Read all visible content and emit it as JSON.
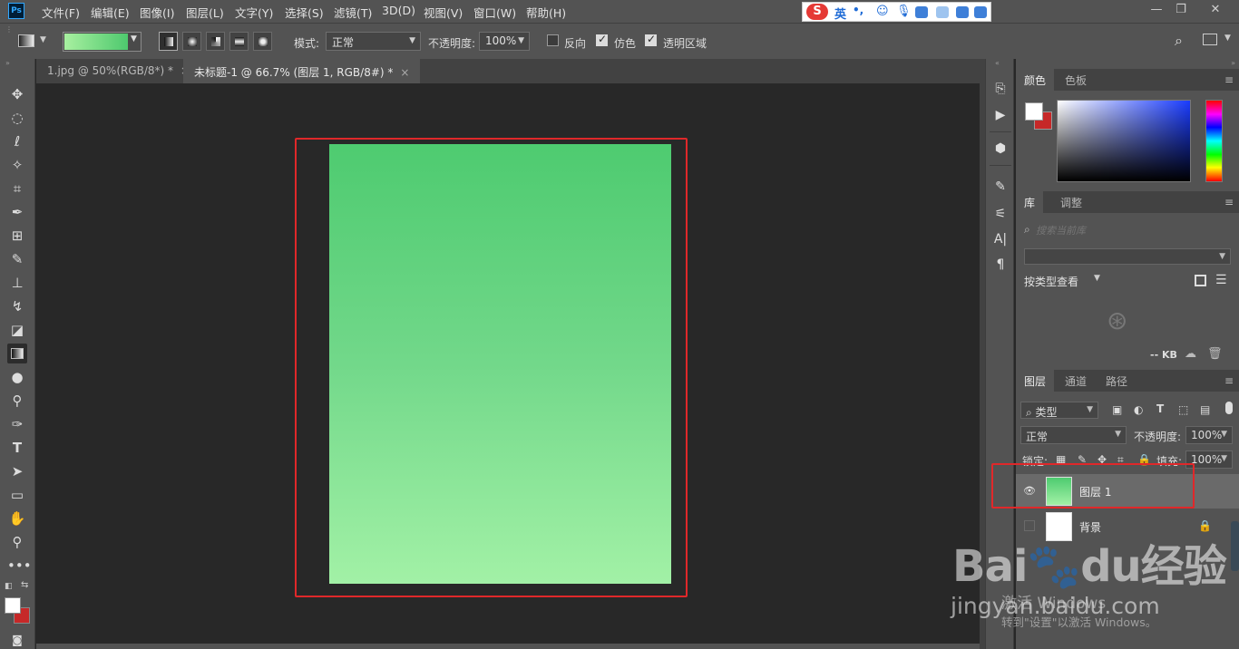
{
  "app": {
    "logo": "Ps",
    "menu": [
      "文件(F)",
      "编辑(E)",
      "图像(I)",
      "图层(L)",
      "文字(Y)",
      "选择(S)",
      "滤镜(T)",
      "3D(D)",
      "视图(V)",
      "窗口(W)",
      "帮助(H)"
    ],
    "ime": {
      "brand": "S",
      "lang": "英",
      "punct": "•,"
    }
  },
  "options": {
    "mode_label": "模式:",
    "mode_value": "正常",
    "opacity_label": "不透明度:",
    "opacity_value": "100%",
    "reverse_label": "反向",
    "reverse_checked": false,
    "dither_label": "仿色",
    "dither_checked": true,
    "transparency_label": "透明区域",
    "transparency_checked": true
  },
  "tabs": [
    {
      "label": "1.jpg @ 50%(RGB/8*) *",
      "close": "×"
    },
    {
      "label": "未标题-1 @ 66.7% (图层 1, RGB/8#) *",
      "close": "×"
    }
  ],
  "colors": {
    "foreground": "#ffffff",
    "background": "#c62828",
    "gradient_start": "#4ecb70",
    "gradient_end": "#a2f1a6",
    "highlight": "#e0282a"
  },
  "panels": {
    "color_tabs": [
      "颜色",
      "色板"
    ],
    "library_tabs": [
      "库",
      "调整"
    ],
    "library_search_placeholder": "搜索当前库",
    "library_view_label": "按类型查看",
    "library_size": "-- KB",
    "layers_tabs": [
      "图层",
      "通道",
      "路径"
    ],
    "layers_filter": "类型",
    "layers_blend": "正常",
    "layers_opacity_label": "不透明度:",
    "layers_opacity_value": "100%",
    "layers_lock_label": "锁定:",
    "layers_fill_label": "填充:",
    "layers_fill_value": "100%",
    "layers": [
      {
        "name": "图层 1",
        "visible": true,
        "selected": true
      },
      {
        "name": "背景",
        "visible": false,
        "locked": true
      }
    ]
  },
  "watermark": {
    "brand": "Bai​🐾du经验",
    "url": "jingyan.baidu.com",
    "activate_title": "激活 Windows",
    "activate_sub": "转到\"设置\"以激活 Windows。"
  }
}
